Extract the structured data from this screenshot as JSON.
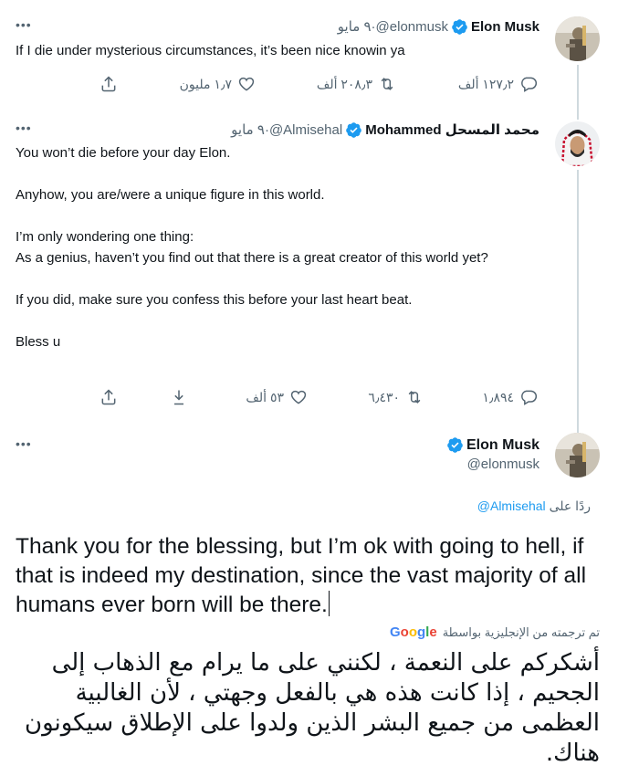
{
  "tweets": [
    {
      "name": "Elon Musk",
      "handle": "@elonmusk",
      "sep": " · ",
      "date": "٩ مايو",
      "text": "If I die under mysterious circumstances, it’s been nice knowin ya",
      "replies": "١٢٧٫٢ ألف",
      "retweets": "٢٠٨٫٣ ألف",
      "likes": "١٫٧ مليون"
    },
    {
      "name": "محمد المسحل Mohammed",
      "handle": "@Almisehal",
      "sep": " · ",
      "date": "٩ مايو",
      "text": "You won’t die before your day Elon.\n\nAnyhow, you are/were a unique figure in this world.\n\nI’m only wondering one thing:\nAs a genius, haven’t you find out that there is a great creator of this world yet?\n\nIf you did, make sure you confess this before your last heart beat.\n\nBless u",
      "replies": "١٫٨٩٤",
      "retweets": "٦٫٤٣٠",
      "likes": "٥٣ ألف"
    }
  ],
  "main": {
    "name": "Elon Musk",
    "handle": "@elonmusk",
    "reply_prefix": "ردًا على",
    "reply_mention": "@Almisehal",
    "text": "Thank you for the blessing, but I’m ok with going to hell, if that is indeed my destination, since the vast majority of all humans ever born will be there.",
    "translated_by": "تم ترجمته من الإنجليزية بواسطة",
    "google": [
      "G",
      "o",
      "o",
      "g",
      "l",
      "e"
    ],
    "translation": "أشكركم على النعمة ، لكنني على ما يرام مع الذهاب إلى الجحيم ، إذا كانت هذه هي بالفعل وجهتي ، لأن الغالبية العظمى من جميع البشر الذين ولدوا على الإطلاق سيكونون هناك."
  },
  "more_glyph": "•••",
  "colors": {
    "verified": "#1d9bf0",
    "muted": "#536471",
    "link": "#1d9bf0",
    "thread": "#cfd9de"
  },
  "icons": [
    "verified-badge-icon",
    "reply-icon",
    "retweet-icon",
    "like-icon",
    "share-icon",
    "bookmark-icon",
    "more-icon"
  ]
}
